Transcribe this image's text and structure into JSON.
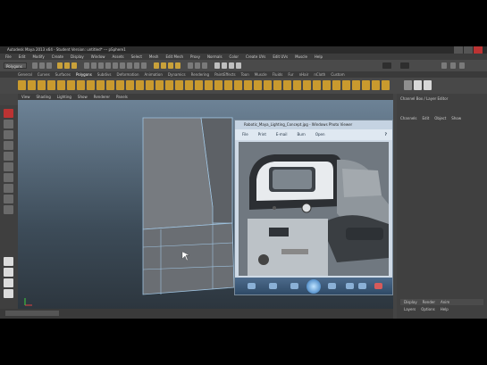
{
  "window": {
    "title": "Autodesk Maya 2013 x64 - Student Version: untitled* --- pSphere1"
  },
  "menubar": {
    "items": [
      "File",
      "Edit",
      "Modify",
      "Create",
      "Display",
      "Window",
      "Assets",
      "Select",
      "Mesh",
      "Edit Mesh",
      "Proxy",
      "Normals",
      "Color",
      "Create UVs",
      "Edit UVs",
      "Muscle",
      "Help"
    ]
  },
  "status": {
    "mode": "Polygons"
  },
  "shelf": {
    "tabs": [
      "General",
      "Curves",
      "Surfaces",
      "Polygons",
      "Subdivs",
      "Deformation",
      "Animation",
      "Dynamics",
      "Rendering",
      "PaintEffects",
      "Toon",
      "Muscle",
      "Fluids",
      "Fur",
      "nHair",
      "nCloth",
      "Custom"
    ],
    "active_tab": "Polygons"
  },
  "viewport": {
    "menu": [
      "View",
      "Shading",
      "Lighting",
      "Show",
      "Renderer",
      "Panels"
    ]
  },
  "channelbox": {
    "header": "Channel Box / Layer Editor",
    "tabs": [
      "Channels",
      "Edit",
      "Object",
      "Show"
    ],
    "layer_tabs": [
      "Display",
      "Render",
      "Anim"
    ],
    "layer_menu": [
      "Layers",
      "Options",
      "Help"
    ]
  },
  "viewer": {
    "title": "Robotic_Maya_Lighting_Concept.jpg - Windows Photo Viewer",
    "menu": [
      "File",
      "Print",
      "E-mail",
      "Burn",
      "Open"
    ]
  }
}
